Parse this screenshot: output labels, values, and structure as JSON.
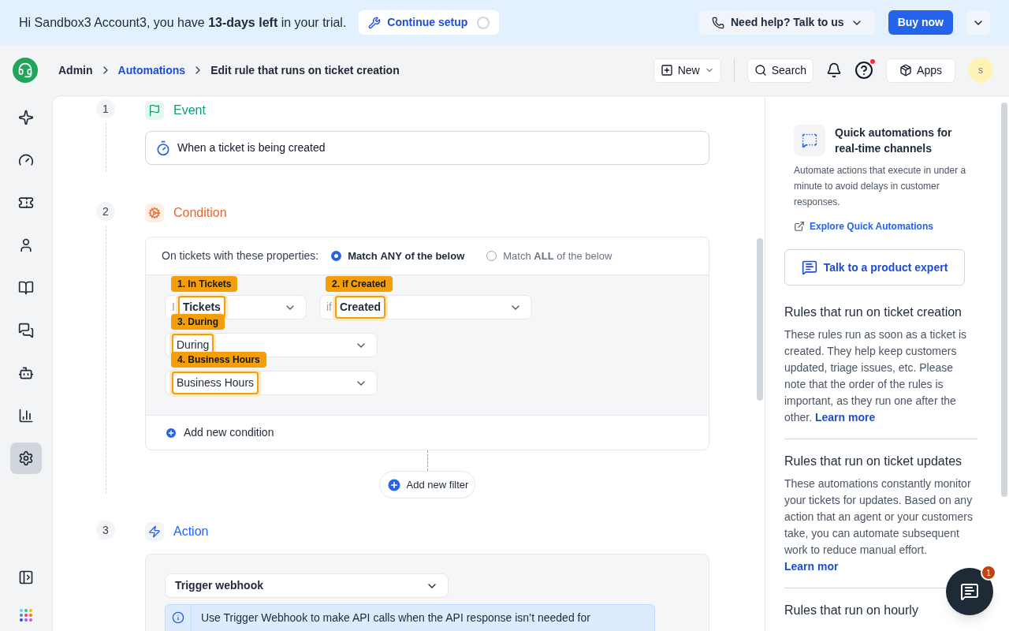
{
  "banner": {
    "greeting": "Hi Sandbox3 Account3, you have **13-days left** in your trial.",
    "setup_button": "Continue setup",
    "help_button": "Need help? Talk to us",
    "buy_button": "Buy now"
  },
  "breadcrumbs": [
    {
      "label": "Admin",
      "kind": "plain"
    },
    {
      "label": "Automations",
      "kind": "link"
    },
    {
      "label": "Edit rule that runs on ticket creation",
      "kind": "current"
    }
  ],
  "header": {
    "new_button": "New",
    "search_button": "Search",
    "apps_button": "Apps",
    "avatar": "s"
  },
  "sidebar": {
    "items": [
      {
        "kind": "sparkle",
        "selected": false
      },
      {
        "kind": "gauge",
        "selected": false
      },
      {
        "kind": "ticket",
        "selected": false
      },
      {
        "kind": "user",
        "selected": false
      },
      {
        "kind": "book",
        "selected": false
      },
      {
        "kind": "chat",
        "selected": false
      },
      {
        "kind": "bot",
        "selected": false
      },
      {
        "kind": "report",
        "selected": false
      },
      {
        "kind": "settings",
        "selected": true
      }
    ]
  },
  "steps": [
    {
      "kind": "event",
      "number": "1",
      "title": "Event",
      "trigger": "When a ticket is being created"
    },
    {
      "kind": "condition",
      "number": "2",
      "title": "Condition",
      "properties_label": "On tickets with these properties:",
      "match_options": [
        {
          "label": "Match **ANY** of the below",
          "selected": true
        },
        {
          "label": "Match **ALL** of the below",
          "selected": false
        }
      ],
      "rows": [
        [
          {
            "prefix": "I",
            "value": "Tickets",
            "tag": "1. In Tickets"
          },
          {
            "prefix": "if",
            "value": "Created",
            "tag": "2. if Created"
          }
        ],
        [
          {
            "value": "During",
            "tag": "3. During"
          }
        ],
        [
          {
            "value": "Business Hours",
            "tag": "4. Business Hours"
          }
        ]
      ],
      "add_condition": "Add new condition",
      "add_filter": "Add new filter"
    },
    {
      "kind": "action",
      "number": "3",
      "title": "Action",
      "action_select": "Trigger webhook",
      "info": "Use Trigger Webhook to make API calls when the API response isn’t needed for"
    }
  ],
  "right_panel": {
    "quick_title": "Quick automations for real-time channels",
    "quick_text": "Automate actions that execute in under a minute to avoid delays in customer responses.",
    "quick_link": "Explore Quick Automations",
    "expert_button": "Talk to a product expert",
    "sections": [
      {
        "title": "Rules that run on ticket creation",
        "body": "These rules run as soon as a ticket is created. They help keep customers updated, triage issues, etc. Please note that the order of the rules is important, as they run one after the other.",
        "link": "Learn more"
      },
      {
        "title": "Rules that run on ticket updates",
        "body": "These automations constantly monitor your tickets for updates. Based on any action that an agent or your customers take, you can automate subsequent work to reduce manual effort.",
        "link": "Learn mor"
      },
      {
        "title": "Rules that run on hourly"
      }
    ]
  },
  "chat_widget": {
    "badge": "1"
  }
}
